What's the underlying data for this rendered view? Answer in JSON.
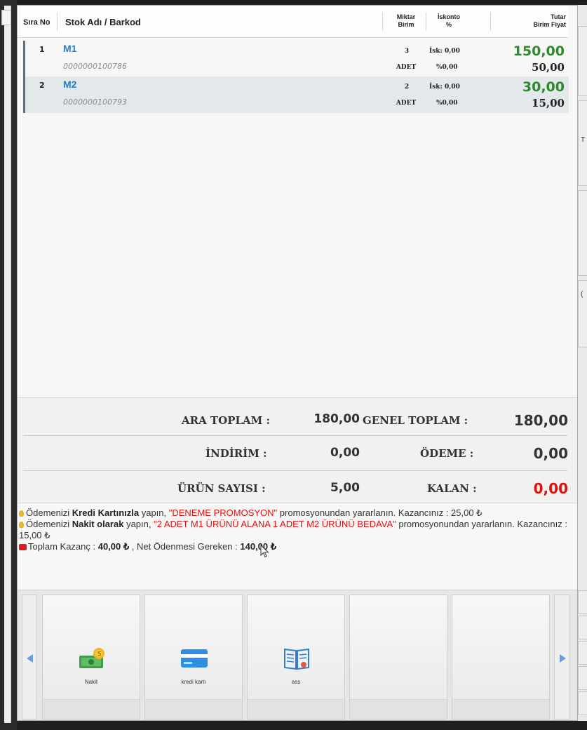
{
  "table": {
    "headers": {
      "sira": "Sıra No",
      "stok": "Stok Adı / Barkod",
      "miktar": "Miktar",
      "birim": "Birim",
      "iskonto": "İskonto",
      "percent": "%",
      "tutar": "Tutar",
      "birim_fiyat": "Birim Fiyat"
    },
    "rows": [
      {
        "no": "1",
        "name": "M1",
        "barcode": "0000000100786",
        "qty": "3",
        "unit": "ADET",
        "isk": "İsk:  0,00",
        "iskp": "%0,00",
        "total": "150,00",
        "price": "50,00"
      },
      {
        "no": "2",
        "name": "M2",
        "barcode": "0000000100793",
        "qty": "2",
        "unit": "ADET",
        "isk": "İsk:  0,00",
        "iskp": "%0,00",
        "total": "30,00",
        "price": "15,00"
      }
    ]
  },
  "totals": {
    "ara_toplam_label": "ARA TOPLAM :",
    "ara_toplam": "180,00",
    "genel_toplam_label": "GENEL TOPLAM :",
    "genel_toplam": "180,00",
    "indirim_label": "İNDİRİM :",
    "indirim": "0,00",
    "odeme_label": "ÖDEME :",
    "odeme": "0,00",
    "urun_sayisi_label": "ÜRÜN SAYISI :",
    "urun_sayisi": "5,00",
    "kalan_label": "KALAN :",
    "kalan": "0,00"
  },
  "promo": {
    "l1_pre": "Ödemenizi ",
    "l1_bold": "Kredi Kartınızla",
    "l1_mid": "  yapın, ",
    "l1_red": "\"DENEME PROMOSYON\"",
    "l1_post": " promosyonundan yararlanın. Kazancınız : 25,00 ₺",
    "l2_pre": "Ödemenizi ",
    "l2_bold": "Nakit olarak",
    "l2_mid": "  yapın, ",
    "l2_red": "\"2 ADET M1 ÜRÜNÜ ALANA 1 ADET M2 ÜRÜNÜ BEDAVA\"",
    "l2_post": " promosyonundan yararlanın. Kazancınız : 15,00 ₺",
    "l3_pre": "Toplam Kazanç : ",
    "l3_kazanc": "40,00 ₺",
    "l3_mid": " , Net Ödenmesi Gereken : ",
    "l3_net": "140,00 ₺"
  },
  "payments": [
    {
      "label": "Nakit",
      "icon": "cash-icon"
    },
    {
      "label": "kredi kartı",
      "icon": "credit-card-icon"
    },
    {
      "label": "ass",
      "icon": "book-icon"
    }
  ],
  "side": {
    "t_label": "T",
    "c_label": "("
  },
  "colors": {
    "green": "#2d8a2d",
    "red": "#e01010",
    "blue": "#1f7ed6"
  }
}
